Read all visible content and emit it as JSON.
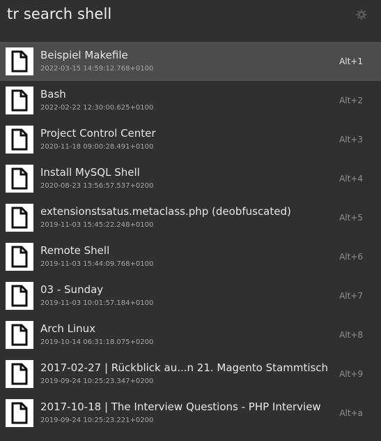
{
  "search": {
    "query": "tr search shell",
    "preferences_icon": "gear-icon"
  },
  "results": [
    {
      "title": "Beispiel Makefile",
      "subtitle": "2022-03-15 14:59:12.768+0100",
      "shortcut": "Alt+1",
      "icon": "file-icon",
      "selected": true
    },
    {
      "title": "Bash",
      "subtitle": "2022-02-22 12:30:00.625+0100",
      "shortcut": "Alt+2",
      "icon": "file-icon"
    },
    {
      "title": "Project Control Center",
      "subtitle": "2020-11-18 09:00:28.491+0100",
      "shortcut": "Alt+3",
      "icon": "file-icon"
    },
    {
      "title": "Install MySQL Shell",
      "subtitle": "2020-08-23 13:56:57.537+0200",
      "shortcut": "Alt+4",
      "icon": "file-icon"
    },
    {
      "title": "extensionstsatus.metaclass.php (deobfuscated)",
      "subtitle": "2019-11-03 15:45:22.248+0100",
      "shortcut": "Alt+5",
      "icon": "file-icon"
    },
    {
      "title": "Remote Shell",
      "subtitle": "2019-11-03 15:44:09.768+0100",
      "shortcut": "Alt+6",
      "icon": "file-icon"
    },
    {
      "title": "03 - Sunday",
      "subtitle": "2019-11-03 10:01:57.184+0100",
      "shortcut": "Alt+7",
      "icon": "file-icon"
    },
    {
      "title": "Arch Linux",
      "subtitle": "2019-10-14 06:31:18.075+0200",
      "shortcut": "Alt+8",
      "icon": "file-icon"
    },
    {
      "title": "2017-02-27 | Rückblick au...n 21. Magento Stammtisch",
      "subtitle": "2019-09-24 10:25:23.347+0200",
      "shortcut": "Alt+9",
      "icon": "file-icon"
    },
    {
      "title": "2017-10-18 | The Interview Questions - PHP Interview",
      "subtitle": "2019-09-24 10:25:23.221+0200",
      "shortcut": "Alt+a",
      "icon": "file-icon"
    }
  ],
  "colors": {
    "background": "#303030",
    "selected_row": "#4c4c4c",
    "title_text": "#e8e8e8",
    "subtitle_text": "#a8a8a8",
    "shortcut_text": "#8f8f8f"
  }
}
